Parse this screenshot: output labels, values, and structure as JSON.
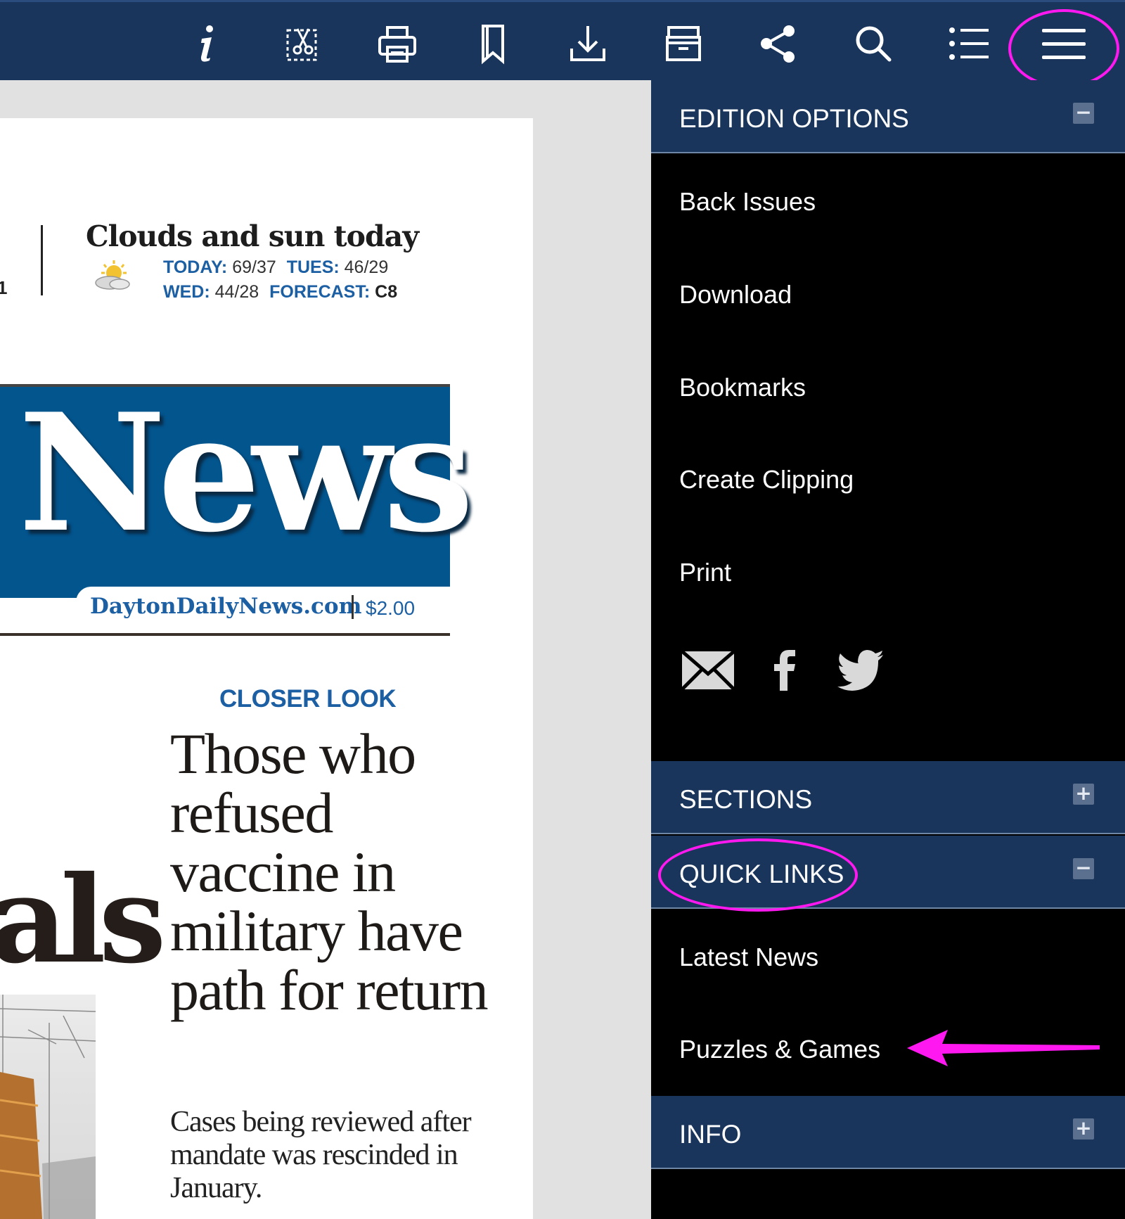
{
  "colors": {
    "toolbar_bg": "#1a355b",
    "sidebar_bg": "#000000",
    "section_header_bg": "#1a355b",
    "masthead_blue": "#03558e",
    "accent_blue": "#1c5fa3",
    "annotation_magenta": "#ff19f0"
  },
  "toolbar": {
    "buttons": [
      {
        "name": "info-icon"
      },
      {
        "name": "clipping-icon"
      },
      {
        "name": "print-icon"
      },
      {
        "name": "bookmark-icon"
      },
      {
        "name": "download-icon"
      },
      {
        "name": "archive-icon"
      },
      {
        "name": "share-icon"
      },
      {
        "name": "search-icon"
      },
      {
        "name": "list-icon"
      },
      {
        "name": "menu-icon"
      }
    ]
  },
  "newspaper": {
    "weather": {
      "headline": "Clouds and sun today",
      "edge_char": "1",
      "today_label": "TODAY:",
      "today_value": "69/37",
      "tues_label": "TUES:",
      "tues_value": "46/29",
      "wed_label": "WED:",
      "wed_value": "44/28",
      "forecast_label": "FORECAST:",
      "forecast_value": "C8"
    },
    "masthead": "News",
    "site_url": "DaytonDailyNews.com",
    "price": "$2.00",
    "kicker": "CLOSER LOOK",
    "headline": "Those who refused vaccine in military have path for return",
    "deck": "Cases being reviewed after mandate was rescinded in January.",
    "cut_headline": "als"
  },
  "sidebar": {
    "edition_options": {
      "title": "EDITION OPTIONS",
      "toggle": "−",
      "items": [
        "Back Issues",
        "Download",
        "Bookmarks",
        "Create Clipping",
        "Print"
      ],
      "social": [
        "email-icon",
        "facebook-icon",
        "twitter-icon"
      ]
    },
    "sections": {
      "title": "SECTIONS",
      "toggle": "+"
    },
    "quick_links": {
      "title": "QUICK LINKS",
      "toggle": "−",
      "items": [
        "Latest News",
        "Puzzles & Games"
      ]
    },
    "info": {
      "title": "INFO",
      "toggle": "+"
    }
  }
}
